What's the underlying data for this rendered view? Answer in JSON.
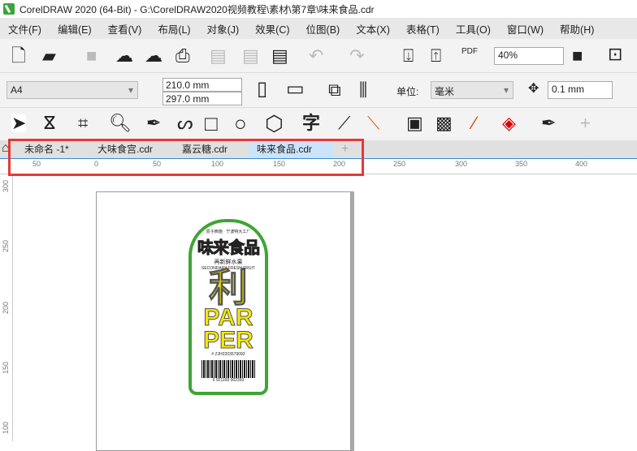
{
  "title": "CorelDRAW 2020 (64-Bit) - G:\\CorelDRAW2020视频教程\\素材\\第7章\\味来食品.cdr",
  "menu": [
    "文件(F)",
    "编辑(E)",
    "查看(V)",
    "布局(L)",
    "对象(J)",
    "效果(C)",
    "位图(B)",
    "文本(X)",
    "表格(T)",
    "工具(O)",
    "窗口(W)",
    "帮助(H)"
  ],
  "toolbar": {
    "zoom": "40%",
    "pdf": "PDF"
  },
  "property_bar": {
    "page_size": "A4",
    "width": "210.0 mm",
    "height": "297.0 mm",
    "unit_label": "单位:",
    "unit": "毫米",
    "nudge": "0.1 mm"
  },
  "toolbox": {
    "text_tool": "字"
  },
  "tabs": [
    {
      "label": "未命名 -1*",
      "active": false
    },
    {
      "label": "大味食宫.cdr",
      "active": false
    },
    {
      "label": "嘉云糖.cdr",
      "active": false
    },
    {
      "label": "味来食品.cdr",
      "active": true
    }
  ],
  "ruler": {
    "h": [
      "50",
      "0",
      "50",
      "100",
      "150",
      "200",
      "250",
      "300",
      "350",
      "400"
    ],
    "v": [
      "300",
      "250",
      "200",
      "150",
      "100"
    ]
  },
  "label": {
    "top": "原子西施 · 宁波特大工厂",
    "brand": "味来食品",
    "sub_cn": "再新鲜水果",
    "sub_en": "SECONDARY FRESH FRUIT",
    "big1": "利",
    "big2": "PAR",
    "big3": "PER",
    "code": "# ZJH2203579092",
    "barcode": "6 921169 002350"
  }
}
